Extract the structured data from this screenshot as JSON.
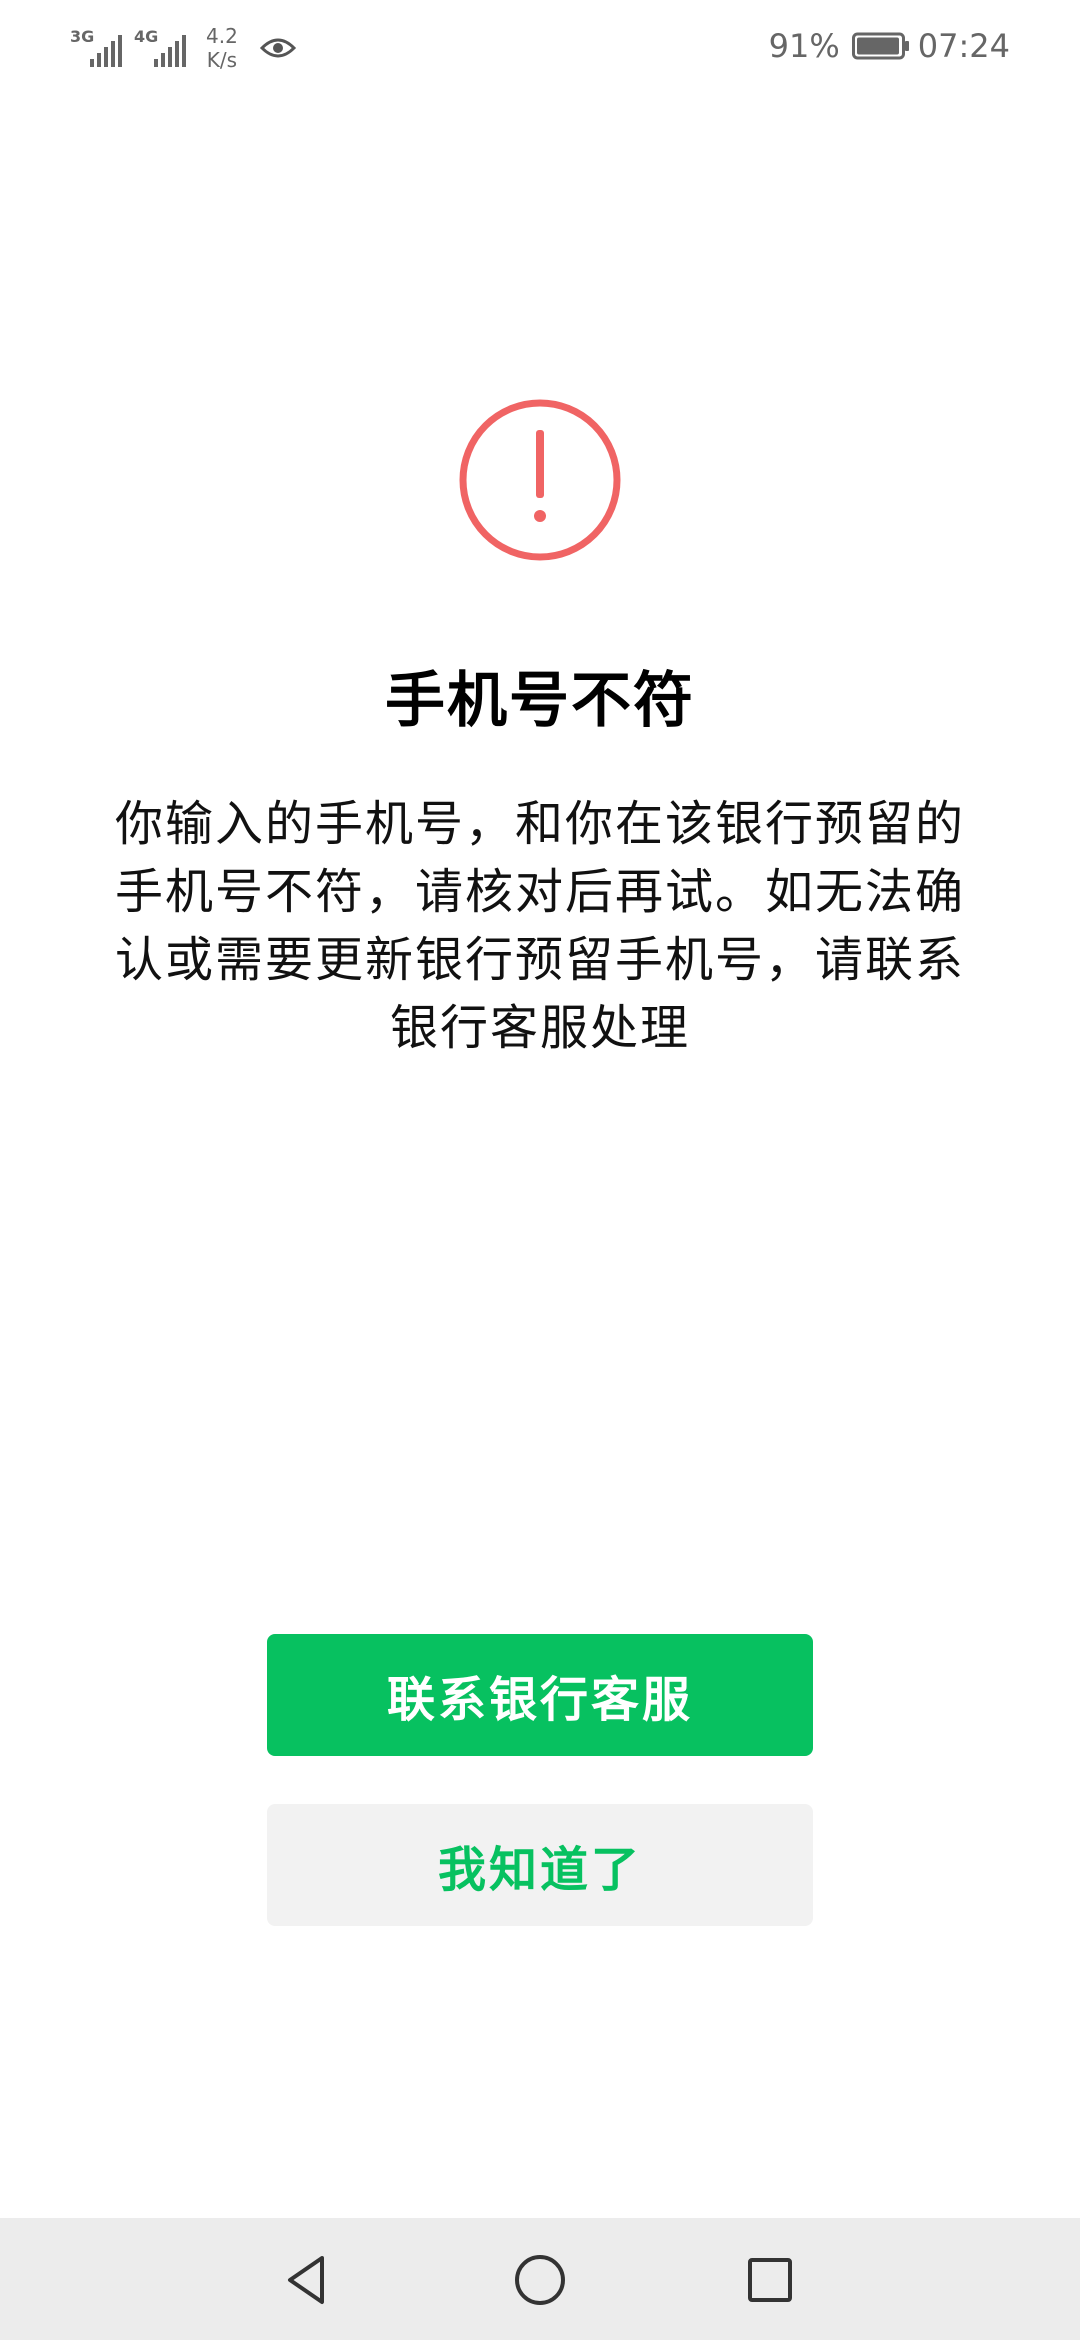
{
  "status_bar": {
    "network1": "3G",
    "network2": "4G",
    "speed_value": "4.2",
    "speed_unit": "K/s",
    "battery": "91%",
    "time": "07:24",
    "icons": [
      "signal-icon",
      "eye-icon",
      "battery-icon"
    ]
  },
  "dialog": {
    "icon": "exclamation-circle-icon",
    "title": "手机号不符",
    "message": "你输入的手机号，和你在该银行预留的手机号不符，请核对后再试。如无法确认或需要更新银行预留手机号，请联系银行客服处理"
  },
  "buttons": {
    "primary_label": "联系银行客服",
    "secondary_label": "我知道了"
  },
  "nav_bar": {
    "icons": [
      "back-icon",
      "home-icon",
      "recent-apps-icon"
    ]
  },
  "colors": {
    "accent": "#07c160",
    "alert": "#f06464",
    "secondary_bg": "#f2f2f2",
    "nav_bg": "#ececec"
  }
}
